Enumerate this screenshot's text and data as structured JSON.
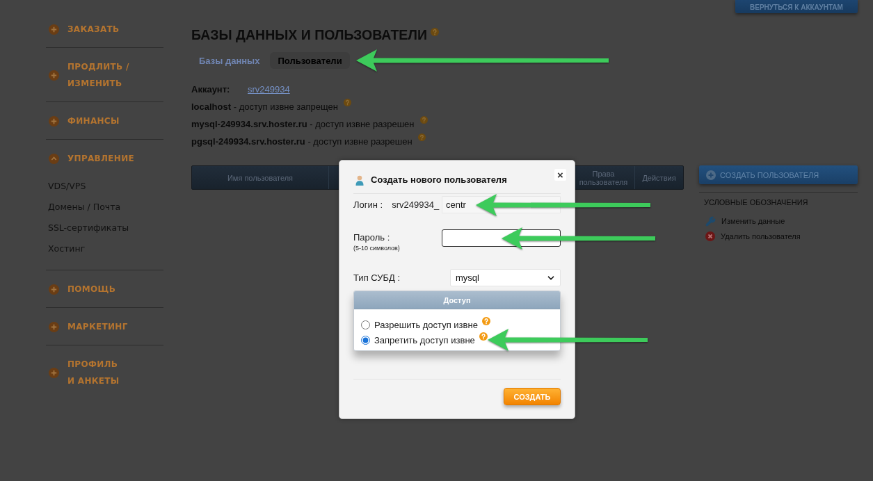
{
  "sidebar": {
    "sections": [
      {
        "label": "ЗАКАЗАТЬ",
        "expanded": false
      },
      {
        "label": "ПРОДЛИТЬ /\nИЗМЕНИТЬ",
        "expanded": false
      },
      {
        "label": "ФИНАНСЫ",
        "expanded": false
      },
      {
        "label": "УПРАВЛЕНИЕ",
        "expanded": true,
        "children": [
          {
            "label": "VDS/VPS"
          },
          {
            "label": "Домены / Почта"
          },
          {
            "label": "SSL-сертификаты"
          },
          {
            "label": "Хостинг"
          }
        ]
      },
      {
        "label": "ПОМОЩЬ",
        "expanded": false
      },
      {
        "label": "МАРКЕТИНГ",
        "expanded": false
      },
      {
        "label": "ПРОФИЛЬ\nИ АНКЕТЫ",
        "expanded": false
      }
    ]
  },
  "page": {
    "title": "БАЗЫ ДАННЫХ И ПОЛЬЗОВАТЕЛИ",
    "tabs": [
      {
        "label": "Базы данных",
        "selected": false,
        "arrow_annotation": false
      },
      {
        "label": "Пользователи",
        "selected": true,
        "arrow_annotation": true
      }
    ],
    "account": {
      "label": "Аккаунт:",
      "link": "srv249934"
    },
    "hosts": [
      "**localhost** - доступ извне запрещен",
      "**mysql-249934.srv.hoster.ru** - доступ извне разрешен",
      "**pgsql-249934.srv.hoster.ru** - доступ извне разрешен"
    ],
    "table": {
      "columns": [
        "Имя пользователя",
        "Права пользователя",
        "Действия"
      ]
    }
  },
  "right_panel": {
    "back_button": "ВЕРНУТЬСЯ К АККАУНТАМ",
    "create_button": "СОЗДАТЬ ПОЛЬЗОВАТЕЛЯ",
    "legend": {
      "title": "УСЛОВНЫЕ ОБОЗНАЧЕНИЯ",
      "items": [
        {
          "kind": "edit",
          "label": "Изменить данные"
        },
        {
          "kind": "delete",
          "label": "Удалить пользователя"
        }
      ]
    }
  },
  "dialog": {
    "title": "Создать нового пользователя",
    "close": "×",
    "login": {
      "label": "Логин :",
      "prefix": "srv249934_",
      "value": "centr",
      "arrow_annotation": true
    },
    "password": {
      "label": "Пароль :",
      "hint": "(5-10 символов)",
      "focused": true,
      "arrow_annotation": true
    },
    "db_type": {
      "label": "Тип СУБД :",
      "value": "mysql"
    },
    "access": {
      "title": "Доступ",
      "options": [
        {
          "label": "Разрешить доступ извне",
          "selected": false,
          "arrow_annotation": false
        },
        {
          "label": "Запретить доступ извне",
          "selected": true,
          "arrow_annotation": true
        }
      ]
    },
    "submit": "СОЗДАТЬ"
  }
}
